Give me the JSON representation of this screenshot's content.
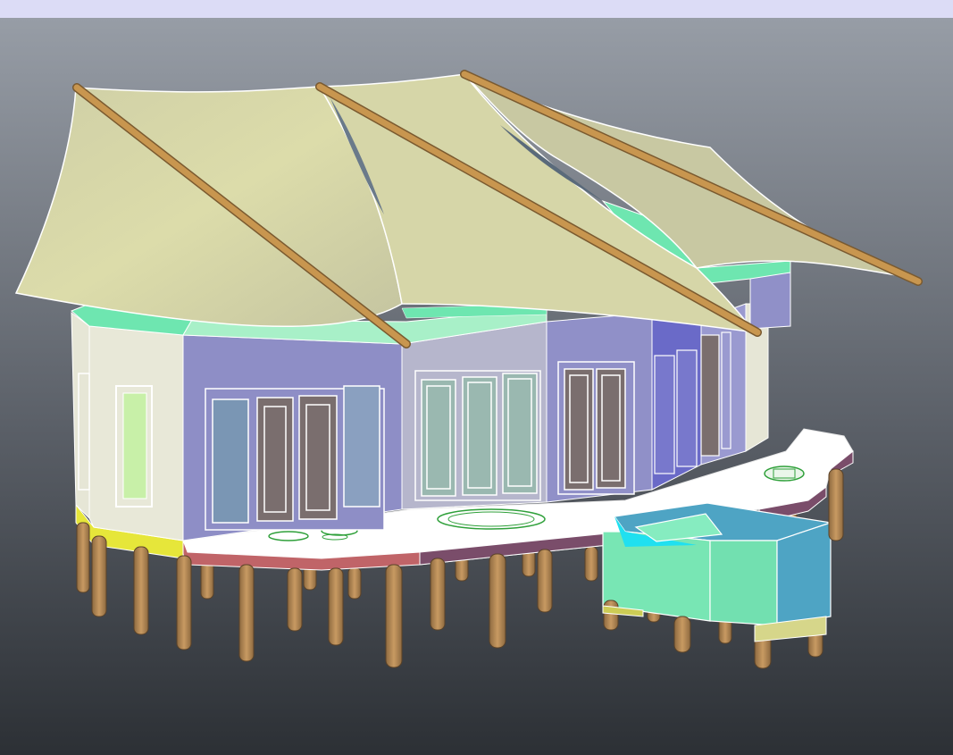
{
  "viewport": {
    "background_top": "#979da6",
    "background_bottom": "#2c3035",
    "titlebar_color": "#dcdcf6"
  },
  "model": {
    "canopy_color": "#cccca4",
    "pole_color": "#c8964f",
    "wall_lavender": "#8e8ec6",
    "wall_cream": "#e8e8d8",
    "wall_grey": "#b6b6cc",
    "trim_mint": "#6ee6b0",
    "deck_color": "#ffffff",
    "deck_edge": "#7a4d6a",
    "deck_edge_warm": "#c06468",
    "stilt_color": "#b98a55",
    "base_yellow": "#e6e63a",
    "spa_green": "#78e6b4",
    "spa_blue": "#4ea4c4",
    "glass_blue": "#7a96b4",
    "glass_pale": "#9ab8b0",
    "door_brown": "#7a6e6e"
  }
}
